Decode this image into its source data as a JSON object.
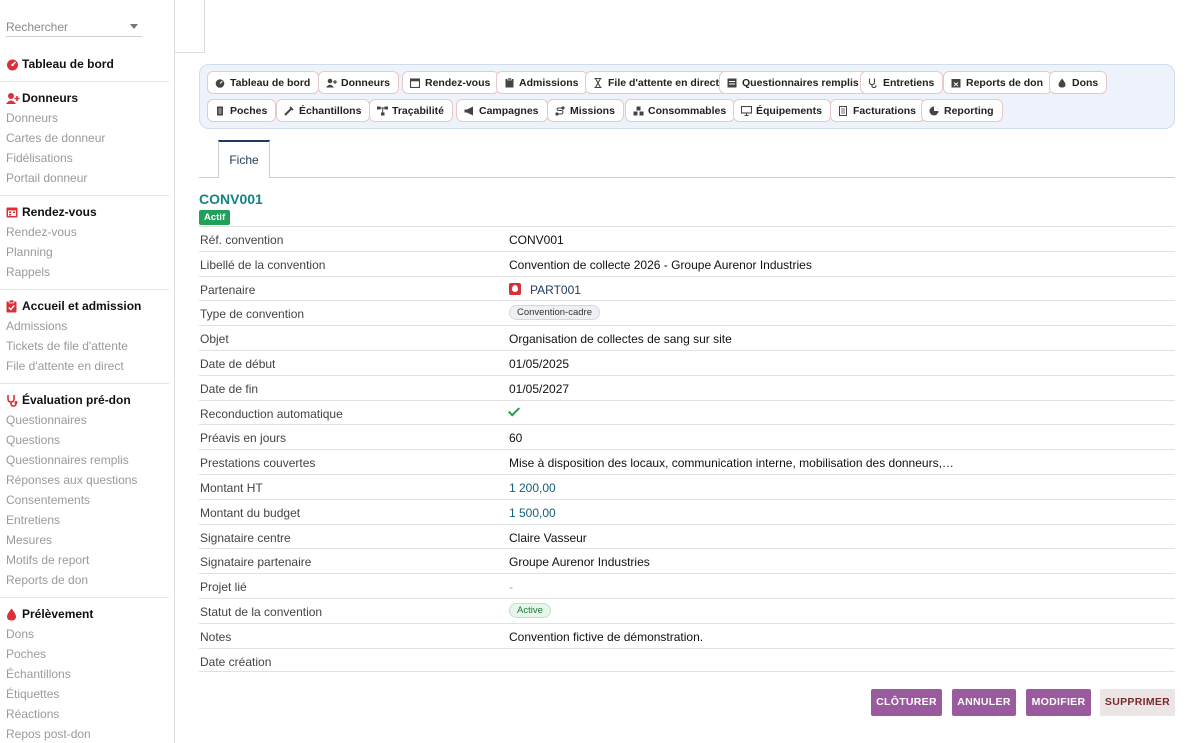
{
  "search": {
    "placeholder": "Rechercher"
  },
  "sidebar": {
    "dashboard": "Tableau de bord",
    "sections": [
      {
        "title": "Donneurs",
        "icon": "user-plus-icon",
        "items": [
          "Donneurs",
          "Cartes de donneur",
          "Fidélisations",
          "Portail donneur"
        ]
      },
      {
        "title": "Rendez-vous",
        "icon": "calendar-icon",
        "items": [
          "Rendez-vous",
          "Planning",
          "Rappels"
        ]
      },
      {
        "title": "Accueil et admission",
        "icon": "clipboard-check-icon",
        "items": [
          "Admissions",
          "Tickets de file d'attente",
          "File d'attente en direct"
        ]
      },
      {
        "title": "Évaluation pré-don",
        "icon": "stethoscope-icon",
        "items": [
          "Questionnaires",
          "Questions",
          "Questionnaires remplis",
          "Réponses aux questions",
          "Consentements",
          "Entretiens",
          "Mesures",
          "Motifs de report",
          "Reports de don"
        ]
      },
      {
        "title": "Prélèvement",
        "icon": "blood-drop-icon",
        "items": [
          "Dons",
          "Poches",
          "Échantillons",
          "Étiquettes",
          "Réactions",
          "Repos post-don"
        ]
      }
    ]
  },
  "nav": {
    "row1": [
      {
        "label": "Tableau de bord",
        "icon": "gauge-icon"
      },
      {
        "label": "Donneurs",
        "icon": "user-plus-icon"
      },
      {
        "label": "Rendez-vous",
        "icon": "calendar-icon"
      },
      {
        "label": "Admissions",
        "icon": "clipboard-icon"
      },
      {
        "label": "File d'attente en direct",
        "icon": "hourglass-icon"
      },
      {
        "label": "Questionnaires remplis",
        "icon": "form-icon"
      },
      {
        "label": "Entretiens",
        "icon": "stethoscope-icon"
      },
      {
        "label": "Reports de don",
        "icon": "calendar-x-icon"
      },
      {
        "label": "Dons",
        "icon": "blood-drop-icon"
      }
    ],
    "row2": [
      {
        "label": "Poches",
        "icon": "bag-icon"
      },
      {
        "label": "Échantillons",
        "icon": "pipette-icon"
      },
      {
        "label": "Traçabilité",
        "icon": "network-icon"
      },
      {
        "label": "Campagnes",
        "icon": "megaphone-icon"
      },
      {
        "label": "Missions",
        "icon": "route-icon"
      },
      {
        "label": "Consommables",
        "icon": "boxes-icon"
      },
      {
        "label": "Équipements",
        "icon": "monitor-icon"
      },
      {
        "label": "Facturations",
        "icon": "invoice-icon"
      },
      {
        "label": "Reporting",
        "icon": "pie-chart-icon"
      }
    ]
  },
  "tabs": {
    "fiche": "Fiche"
  },
  "record": {
    "title": "CONV001",
    "status_badge": "Actif",
    "fields": {
      "ref_label": "Réf. convention",
      "ref_value": "CONV001",
      "libelle_label": "Libellé de la convention",
      "libelle_value": "Convention de collecte 2026 - Groupe Aurenor Industries",
      "partenaire_label": "Partenaire",
      "partenaire_value": "PART001",
      "type_label": "Type de convention",
      "type_value": "Convention-cadre",
      "objet_label": "Objet",
      "objet_value": "Organisation de collectes de sang sur site",
      "debut_label": "Date de début",
      "debut_value": "01/05/2025",
      "fin_label": "Date de fin",
      "fin_value": "01/05/2027",
      "reconduction_label": "Reconduction automatique",
      "preavis_label": "Préavis en jours",
      "preavis_value": "60",
      "prestations_label": "Prestations couvertes",
      "prestations_value": "Mise à disposition des locaux, communication interne, mobilisation des donneurs,…",
      "montant_ht_label": "Montant HT",
      "montant_ht_value": "1 200,00",
      "budget_label": "Montant du budget",
      "budget_value": "1 500,00",
      "sig_centre_label": "Signataire centre",
      "sig_centre_value": "Claire Vasseur",
      "sig_partenaire_label": "Signataire partenaire",
      "sig_partenaire_value": "Groupe Aurenor Industries",
      "projet_label": "Projet lié",
      "projet_value": "-",
      "statut_label": "Statut de la convention",
      "statut_value": "Active",
      "notes_label": "Notes",
      "notes_value": "Convention fictive de démonstration.",
      "creation_label": "Date création"
    }
  },
  "actions": {
    "cloturer": "CLÔTURER",
    "annuler": "ANNULER",
    "modifier": "MODIFIER",
    "supprimer": "SUPPRIMER"
  },
  "colors": {
    "accent": "#9a5b9e",
    "title": "#148385",
    "success": "#21a05a",
    "danger": "#d9303a"
  }
}
